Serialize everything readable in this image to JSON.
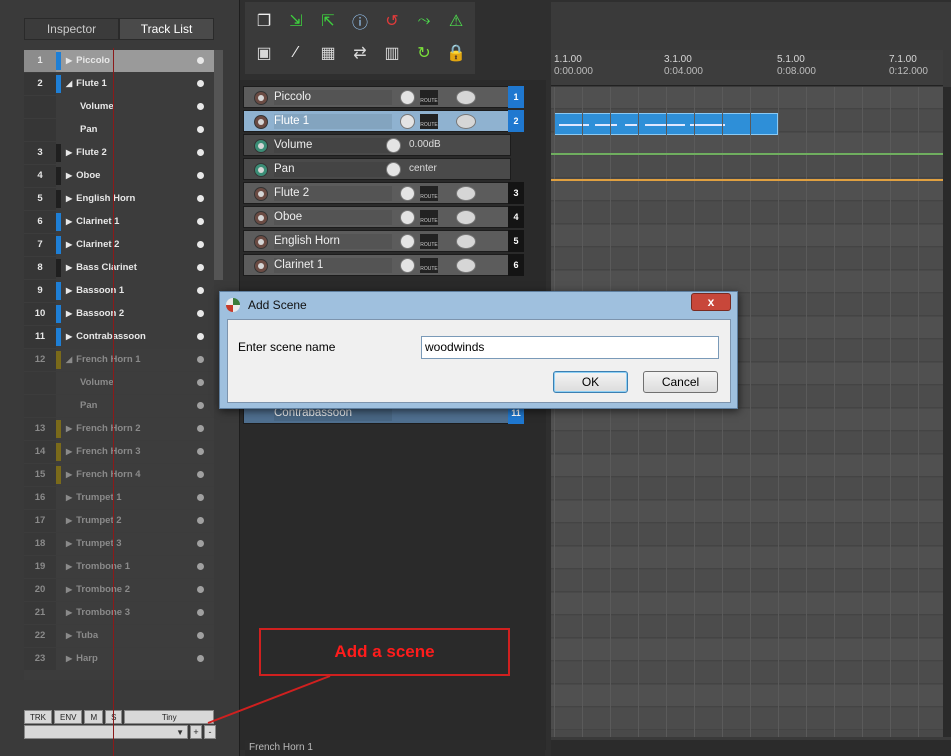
{
  "left_panel": {
    "tabs": [
      "Inspector",
      "Track List"
    ],
    "tracks": [
      {
        "num": "1",
        "name": "Piccolo",
        "arrow": "▶",
        "state": "sel",
        "bar": "#1e7fd6"
      },
      {
        "num": "2",
        "name": "Flute 1",
        "arrow": "◢",
        "state": "normal",
        "bar": "#1e7fd6"
      },
      {
        "num": "",
        "name": "Volume",
        "arrow": "",
        "state": "sub",
        "bar": ""
      },
      {
        "num": "",
        "name": "Pan",
        "arrow": "",
        "state": "sub",
        "bar": ""
      },
      {
        "num": "3",
        "name": "Flute 2",
        "arrow": "▶",
        "state": "normal",
        "bar": "#1f1f1f"
      },
      {
        "num": "4",
        "name": "Oboe",
        "arrow": "▶",
        "state": "normal",
        "bar": "#1f1f1f"
      },
      {
        "num": "5",
        "name": "English Horn",
        "arrow": "▶",
        "state": "normal",
        "bar": "#1f1f1f"
      },
      {
        "num": "6",
        "name": "Clarinet 1",
        "arrow": "▶",
        "state": "normal",
        "bar": "#1e7fd6"
      },
      {
        "num": "7",
        "name": "Clarinet 2",
        "arrow": "▶",
        "state": "normal",
        "bar": "#1e7fd6"
      },
      {
        "num": "8",
        "name": "Bass Clarinet",
        "arrow": "▶",
        "state": "normal",
        "bar": "#1f1f1f"
      },
      {
        "num": "9",
        "name": "Bassoon 1",
        "arrow": "▶",
        "state": "normal",
        "bar": "#1e7fd6"
      },
      {
        "num": "10",
        "name": "Bassoon 2",
        "arrow": "▶",
        "state": "normal",
        "bar": "#1e7fd6"
      },
      {
        "num": "11",
        "name": "Contrabassoon",
        "arrow": "▶",
        "state": "normal",
        "bar": "#1e7fd6"
      },
      {
        "num": "12",
        "name": "French Horn 1",
        "arrow": "◢",
        "state": "dim",
        "bar": "#7a6a1a"
      },
      {
        "num": "",
        "name": "Volume",
        "arrow": "",
        "state": "dimsub",
        "bar": ""
      },
      {
        "num": "",
        "name": "Pan",
        "arrow": "",
        "state": "dimsub",
        "bar": ""
      },
      {
        "num": "13",
        "name": "French Horn 2",
        "arrow": "▶",
        "state": "dim",
        "bar": "#7a6a1a"
      },
      {
        "num": "14",
        "name": "French Horn 3",
        "arrow": "▶",
        "state": "dim",
        "bar": "#7a6a1a"
      },
      {
        "num": "15",
        "name": "French Horn 4",
        "arrow": "▶",
        "state": "dim",
        "bar": "#7a6a1a"
      },
      {
        "num": "16",
        "name": "Trumpet 1",
        "arrow": "▶",
        "state": "dim",
        "bar": ""
      },
      {
        "num": "17",
        "name": "Trumpet 2",
        "arrow": "▶",
        "state": "dim",
        "bar": ""
      },
      {
        "num": "18",
        "name": "Trumpet 3",
        "arrow": "▶",
        "state": "dim",
        "bar": ""
      },
      {
        "num": "19",
        "name": "Trombone 1",
        "arrow": "▶",
        "state": "dim",
        "bar": ""
      },
      {
        "num": "20",
        "name": "Trombone 2",
        "arrow": "▶",
        "state": "dim",
        "bar": ""
      },
      {
        "num": "21",
        "name": "Trombone 3",
        "arrow": "▶",
        "state": "dim",
        "bar": ""
      },
      {
        "num": "22",
        "name": "Tuba",
        "arrow": "▶",
        "state": "dim",
        "bar": ""
      },
      {
        "num": "23",
        "name": "Harp",
        "arrow": "▶",
        "state": "dim",
        "bar": ""
      }
    ],
    "bottom_buttons": [
      "TRK",
      "ENV",
      "M",
      "S",
      "Tiny"
    ],
    "scene_plus": "+",
    "scene_minus": "-"
  },
  "toolbar": {
    "icons": [
      "new-track-icon",
      "import-icon",
      "template-icon",
      "info-icon",
      "loop-icon",
      "envelope-icon",
      "metronome-icon",
      "snap-icon",
      "ripple-icon",
      "grid-icon",
      "move-icon",
      "columns-icon",
      "cycle-icon",
      "lock-icon"
    ]
  },
  "tcp": {
    "rows": [
      {
        "name": "Piccolo",
        "kind": "track",
        "num": "1",
        "sel": false,
        "blue": true
      },
      {
        "name": "Flute 1",
        "kind": "track",
        "num": "2",
        "sel": true,
        "blue": true
      },
      {
        "name": "Volume",
        "kind": "env",
        "value": "0.00dB"
      },
      {
        "name": "Pan",
        "kind": "env",
        "value": "center"
      },
      {
        "name": "Flute 2",
        "kind": "track",
        "num": "3",
        "sel": false,
        "blue": false
      },
      {
        "name": "Oboe",
        "kind": "track",
        "num": "4",
        "sel": false,
        "blue": false
      },
      {
        "name": "English Horn",
        "kind": "track",
        "num": "5",
        "sel": false,
        "blue": false
      },
      {
        "name": "Clarinet 1",
        "kind": "track",
        "num": "6",
        "sel": false,
        "blue": false
      }
    ],
    "last_row": {
      "name": "Contrabassoon",
      "num": "11"
    },
    "route_label": "ROUTE"
  },
  "ruler": {
    "marks": [
      {
        "bar": "1.1.00",
        "time": "0:00.000"
      },
      {
        "bar": "3.1.00",
        "time": "0:04.000"
      },
      {
        "bar": "5.1.00",
        "time": "0:08.000"
      },
      {
        "bar": "7.1.00",
        "time": "0:12.000"
      }
    ]
  },
  "status": {
    "text": "French Horn 1"
  },
  "dialog": {
    "title": "Add Scene",
    "close": "x",
    "label": "Enter scene name",
    "value": "woodwinds",
    "ok": "OK",
    "cancel": "Cancel"
  },
  "annotation": {
    "text": "Add a scene",
    "color": "#ff1c1c"
  }
}
